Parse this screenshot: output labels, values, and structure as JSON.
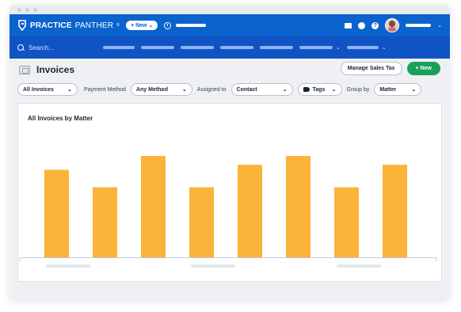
{
  "topbar": {
    "logo_bold": "PRACTICE",
    "logo_light": "PANTHER",
    "logo_mark": "®",
    "new_button": "+ New",
    "colors": {
      "topbar": "#0b63ce",
      "navbar": "#1053c4"
    }
  },
  "navbar": {
    "search_label": "Search..."
  },
  "page": {
    "title": "Invoices",
    "manage_sales_tax": "Manage Sales Tax",
    "new_button": "+ New"
  },
  "filters": {
    "all_invoices": "All Invoices",
    "payment_method_label": "Payment Method",
    "payment_method_value": "Any Method",
    "assigned_to_label": "Assigned to",
    "assigned_to_value": "Contact",
    "tags_value": "Tags",
    "group_by_label": "Group by",
    "group_by_value": "Matter"
  },
  "chart_data": {
    "type": "bar",
    "title": "All Invoices by Matter",
    "values": [
      0.7,
      0.56,
      0.81,
      0.56,
      0.74,
      0.81,
      0.56,
      0.74
    ],
    "color": "#fbb33a"
  }
}
